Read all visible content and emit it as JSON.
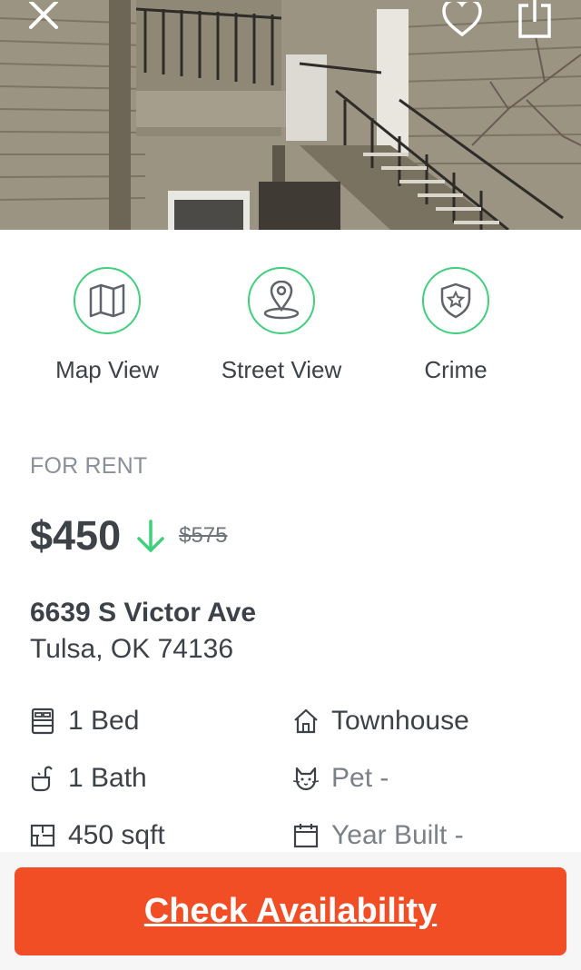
{
  "header": {
    "close_icon": "close-icon",
    "favorite_icon": "heart-icon",
    "share_icon": "share-icon"
  },
  "actions": {
    "map_view": {
      "label": "Map View",
      "icon": "map-icon"
    },
    "street_view": {
      "label": "Street View",
      "icon": "location-pin-icon"
    },
    "crime": {
      "label": "Crime",
      "icon": "shield-star-icon"
    }
  },
  "listing": {
    "status": "FOR RENT",
    "price": "$450",
    "price_trend_icon": "arrow-down-icon",
    "old_price": "$575",
    "street": "6639 S Victor Ave",
    "city_state_zip": "Tulsa, OK 74136"
  },
  "facts": {
    "beds": {
      "label": "1 Bed",
      "icon": "bed-icon"
    },
    "baths": {
      "label": "1 Bath",
      "icon": "bathtub-icon"
    },
    "size": {
      "label": "450 sqft",
      "icon": "floorplan-icon"
    },
    "type": {
      "label": "Townhouse",
      "icon": "house-icon"
    },
    "pets": {
      "label": "Pet -",
      "icon": "cat-icon"
    },
    "year_built": {
      "label": "Year Built -",
      "icon": "calendar-icon"
    }
  },
  "cta": {
    "label": "Check Availability"
  },
  "colors": {
    "accent_green": "#3fd07c",
    "cta_orange": "#f24e25",
    "text_dark": "#3d4148",
    "text_muted": "#8a8f98"
  }
}
